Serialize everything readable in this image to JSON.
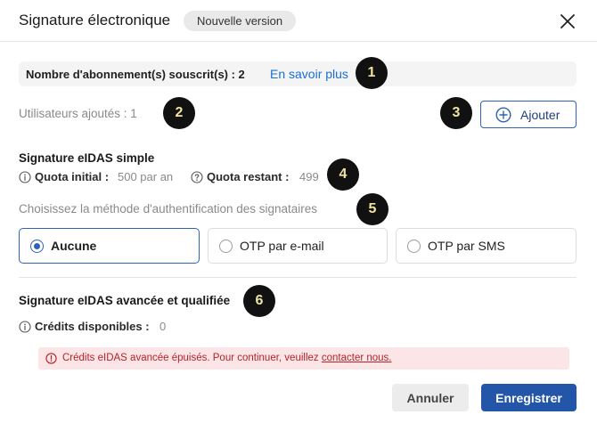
{
  "header": {
    "title": "Signature électronique",
    "badge": "Nouvelle version"
  },
  "subscription": {
    "label": "Nombre d'abonnement(s) souscrit(s) : 2",
    "link": "En savoir plus"
  },
  "users": {
    "label": "Utilisateurs ajoutés : 1",
    "add_label": "Ajouter"
  },
  "simple": {
    "title": "Signature eIDAS simple",
    "quota_initial_label": "Quota initial :",
    "quota_initial_value": "500 par an",
    "quota_remaining_label": "Quota restant :",
    "quota_remaining_value": "499",
    "auth_label": "Choisissez la méthode d'authentification des signataires",
    "options": [
      {
        "label": "Aucune",
        "selected": true
      },
      {
        "label": "OTP par e-mail",
        "selected": false
      },
      {
        "label": "OTP par SMS",
        "selected": false
      }
    ]
  },
  "advanced": {
    "title": "Signature eIDAS avancée et qualifiée",
    "credits_label": "Crédits disponibles :",
    "credits_value": "0",
    "alert_text": "Crédits eIDAS avancée épuisés. Pour continuer, veuillez",
    "alert_link": "contacter nous."
  },
  "markers": [
    "1",
    "2",
    "3",
    "4",
    "5",
    "6"
  ],
  "footer": {
    "cancel_label": "Annuler",
    "save_label": "Enregistrer"
  },
  "icons": {
    "close": "close-icon",
    "add": "plus-circle-icon",
    "info": "info-icon",
    "help": "help-icon",
    "alert": "alert-icon"
  },
  "colors": {
    "accent": "#2e63b3",
    "primary_button": "#2356a8",
    "link": "#1a6fd1",
    "alert_bg": "#fbe5e6",
    "alert_text": "#b42328",
    "marker_bg": "#111111",
    "marker_text": "#f0e4a0"
  }
}
